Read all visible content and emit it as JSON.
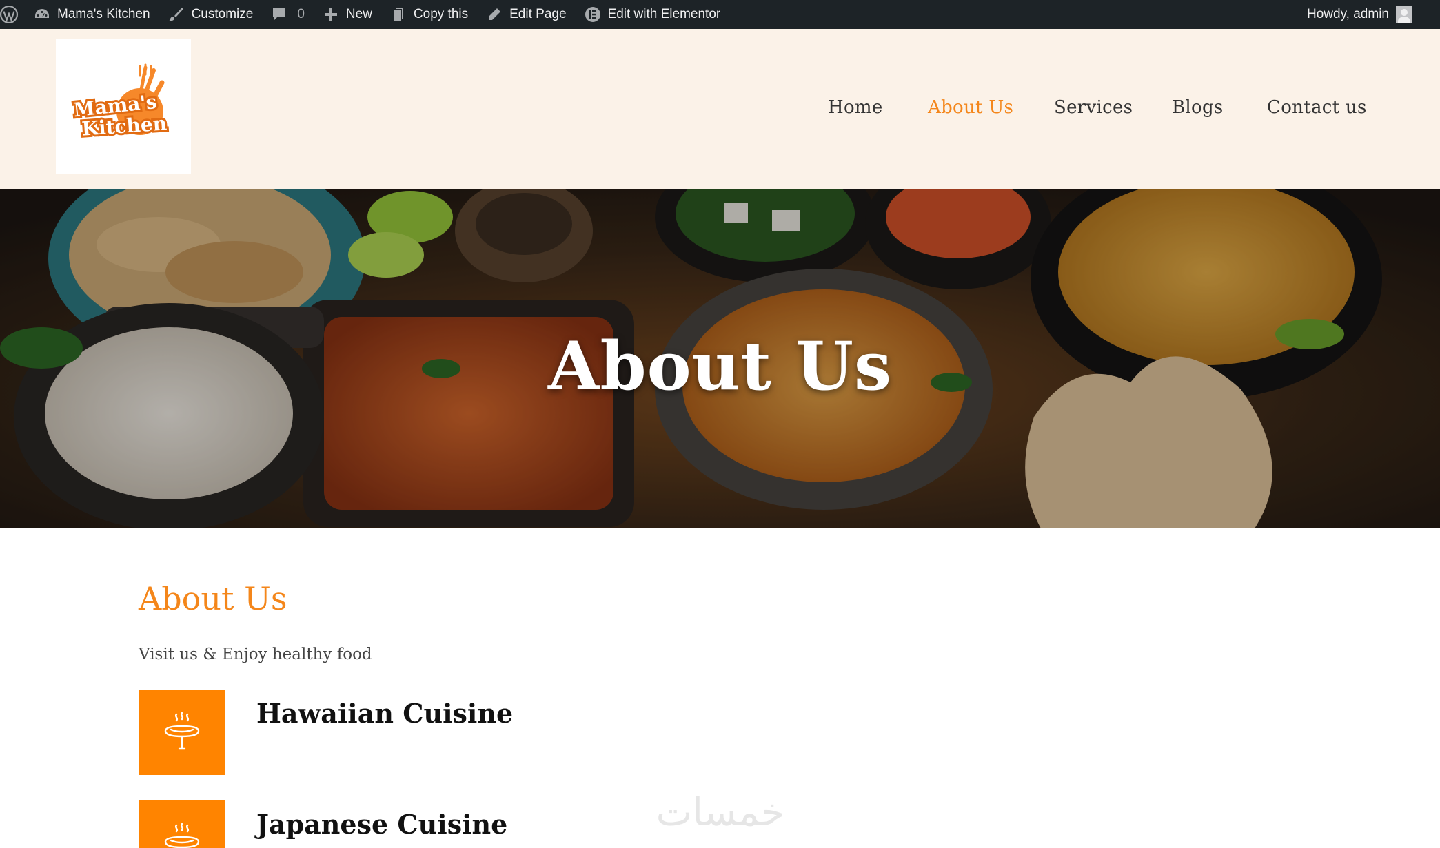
{
  "admin_bar": {
    "site_name": "Mama's Kitchen",
    "customize": "Customize",
    "comments_count": "0",
    "new": "New",
    "copy_this": "Copy this",
    "edit_page": "Edit Page",
    "edit_elementor": "Edit with Elementor",
    "howdy": "Howdy, admin"
  },
  "header": {
    "logo": {
      "line1": "Mama's",
      "line2": "Kitchen"
    },
    "nav": [
      {
        "label": "Home",
        "active": false
      },
      {
        "label": "About Us",
        "active": true
      },
      {
        "label": "Services",
        "active": false
      },
      {
        "label": "Blogs",
        "active": false
      },
      {
        "label": "Contact us",
        "active": false
      }
    ]
  },
  "hero": {
    "title": "About Us"
  },
  "about": {
    "title": "About Us",
    "subtitle": "Visit us & Enjoy healthy food",
    "features": [
      {
        "title": "Hawaiian Cuisine",
        "icon": "grill-sausage-icon"
      },
      {
        "title": "Japanese Cuisine",
        "icon": "grill-sausage-icon"
      }
    ]
  },
  "watermark": "خمسات",
  "colors": {
    "accent": "#f4861a",
    "icon_bg": "#ff8400",
    "admin_bar": "#1d2327",
    "header_bg": "#fbf2e8"
  }
}
